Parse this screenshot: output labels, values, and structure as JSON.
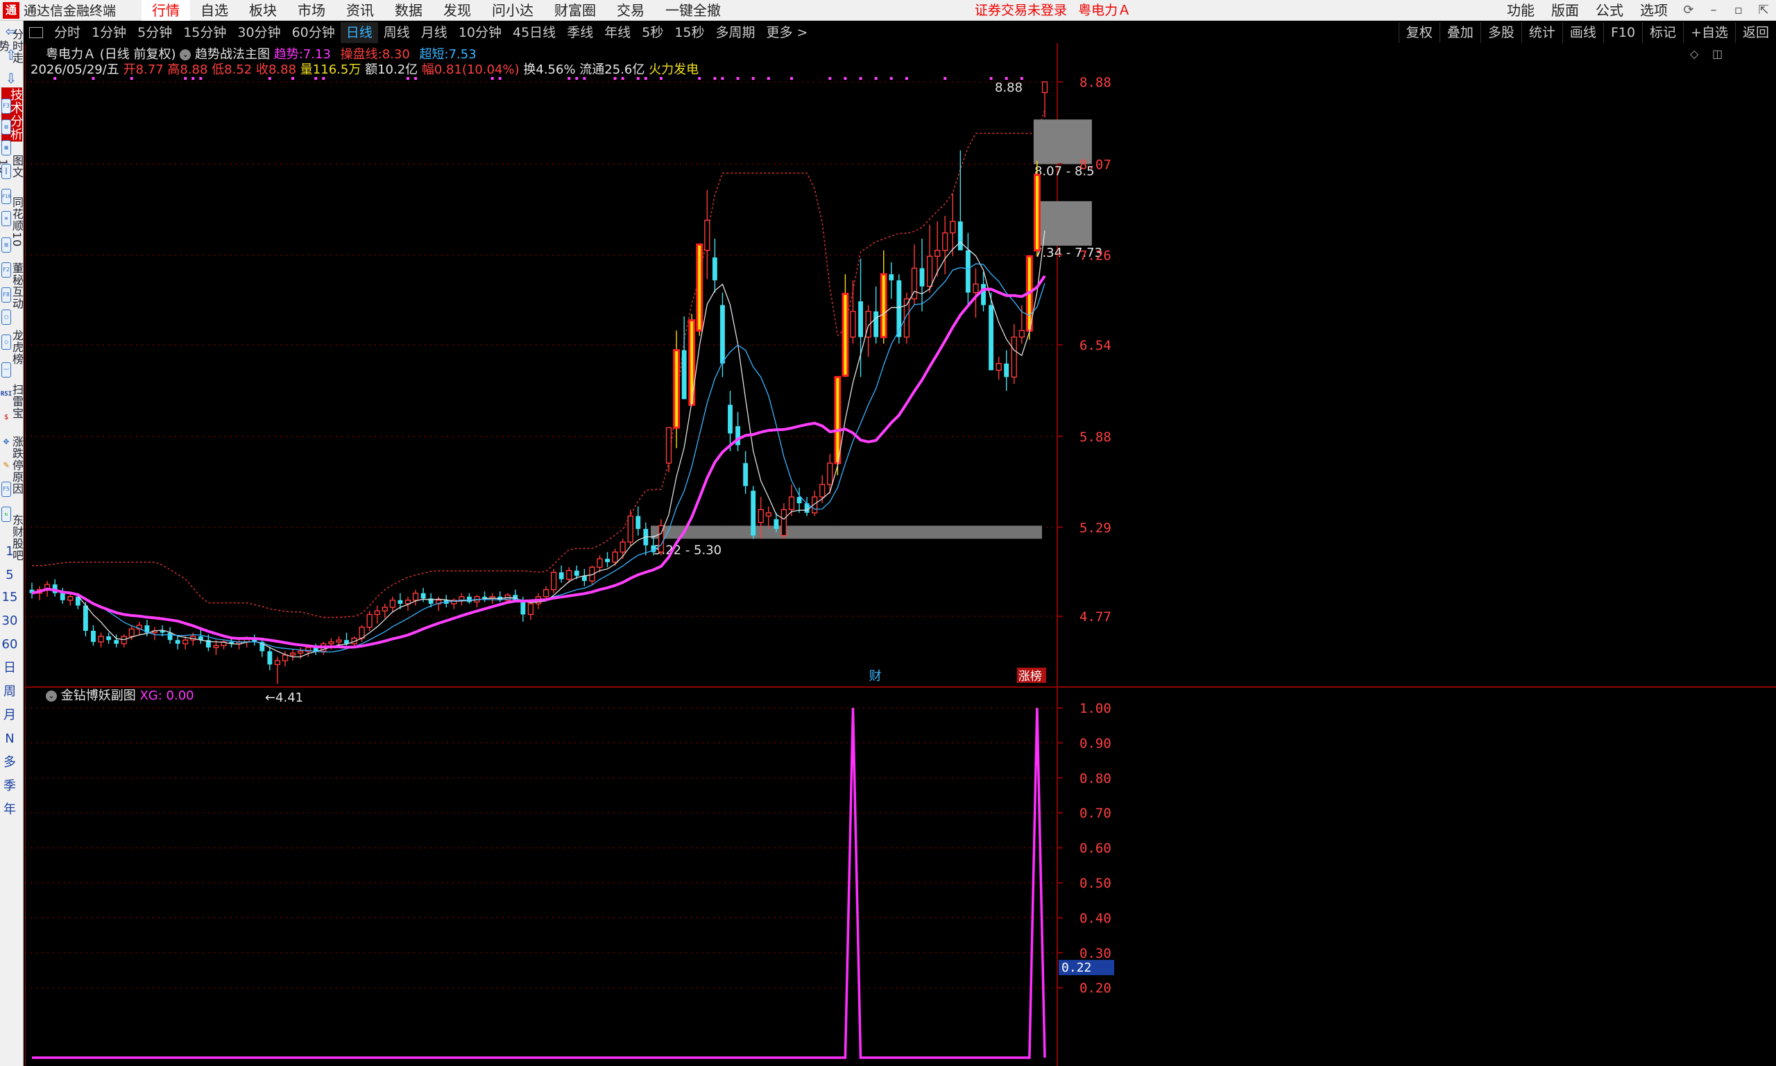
{
  "app": {
    "title": "通达信金融终端"
  },
  "menu": {
    "items": [
      "行情",
      "自选",
      "板块",
      "市场",
      "资讯",
      "数据",
      "发现",
      "问小达",
      "财富圈",
      "交易",
      "一键全撤"
    ],
    "active": "行情",
    "notice": "证券交易未登录",
    "notice_stock": "粤电力Ａ",
    "right": [
      "功能",
      "版面",
      "公式",
      "选项"
    ]
  },
  "sidebar": {
    "tabs": [
      "分时走势",
      "技术分析",
      "图文10",
      "同花顺10",
      "董秘互动",
      "龙虎榜",
      "扫雷宝",
      "涨跌停原因",
      "东财股吧"
    ],
    "active_tab": "技术分析",
    "icons": [
      "chart-icon",
      "grid-icon",
      "rsi-icon",
      "money-icon",
      "move-icon",
      "pencil-icon",
      "fs-icon"
    ],
    "icon_labels": [
      "F3",
      "F10",
      "F2",
      "F8",
      "RSI",
      "$",
      "F5"
    ],
    "periods": [
      "1",
      "5",
      "15",
      "30",
      "60",
      "日",
      "周",
      "月",
      "N",
      "多",
      "季",
      "年"
    ]
  },
  "toolbar": {
    "periods": [
      "分时",
      "1分钟",
      "5分钟",
      "15分钟",
      "30分钟",
      "60分钟",
      "日线",
      "周线",
      "月线",
      "10分钟",
      "45日线",
      "季线",
      "年线",
      "5秒",
      "15秒",
      "多周期",
      "更多 >"
    ],
    "active": "日线",
    "right": [
      "复权",
      "叠加",
      "多股",
      "统计",
      "画线",
      "F10",
      "标记",
      "+自选",
      "返回"
    ]
  },
  "stock": {
    "name": "粤电力Ａ",
    "mode": "(日线 前复权)",
    "formula": "趋势战法主图",
    "trend_label": "趋势:",
    "trend_value": "7.13",
    "control_label": "操盘线:",
    "control_value": "8.30",
    "short_label": "超短:",
    "short_value": "7.53",
    "date": "2026/05/29/五",
    "open_label": "开",
    "open": "8.77",
    "high_label": "高",
    "high": "8.88",
    "low_label": "低",
    "low": "8.52",
    "close_label": "收",
    "close": "8.88",
    "vol_label": "量",
    "vol": "116.5万",
    "amt_label": "额",
    "amt": "10.2亿",
    "chg_label": "幅",
    "chg": "0.81(10.04%)",
    "turnover_label": "换",
    "turnover": "4.56%",
    "float_label": "流通",
    "float": "25.6亿",
    "sector": "火力发电"
  },
  "sub": {
    "name": "金钻博妖副图",
    "xg_label": "XG:",
    "xg_value": "0.00",
    "current_value": "0.22"
  },
  "colors": {
    "up": "#ff3b3b",
    "down": "#40e0f0",
    "ma_long": "#ff40ff",
    "ma_short": "#e0e0e0",
    "band": "#c03030",
    "grid": "#8b0000",
    "box": "#808080",
    "limitup": "#ffdd00"
  },
  "chart_data": {
    "type": "candlestick",
    "y_ticks": [
      "8.88",
      "8.07",
      "7.26",
      "6.54",
      "5.88",
      "5.29",
      "4.77"
    ],
    "sub_y_ticks": [
      "1.00",
      "0.90",
      "0.80",
      "0.70",
      "0.60",
      "0.50",
      "0.40",
      "0.30",
      "0.20"
    ],
    "ylim": [
      4.5,
      8.95
    ],
    "annotations": {
      "low_mark": "←4.41",
      "high_mark": "8.88",
      "box1": "8.07 - 8.5",
      "box2": "7.34 - 7.73",
      "box3": "5.22 - 5.30",
      "tag_cai": "财",
      "tag_zhangbang": "涨榜"
    },
    "candles": [
      [
        4.92,
        4.96,
        4.87,
        4.9
      ],
      [
        4.9,
        4.94,
        4.86,
        4.92
      ],
      [
        4.92,
        4.97,
        4.88,
        4.95
      ],
      [
        4.95,
        4.98,
        4.88,
        4.9
      ],
      [
        4.9,
        4.93,
        4.84,
        4.86
      ],
      [
        4.86,
        4.9,
        4.83,
        4.88
      ],
      [
        4.88,
        4.9,
        4.81,
        4.83
      ],
      [
        4.83,
        4.85,
        4.66,
        4.69
      ],
      [
        4.69,
        4.72,
        4.61,
        4.63
      ],
      [
        4.63,
        4.68,
        4.6,
        4.66
      ],
      [
        4.66,
        4.68,
        4.62,
        4.64
      ],
      [
        4.64,
        4.67,
        4.6,
        4.62
      ],
      [
        4.62,
        4.67,
        4.6,
        4.66
      ],
      [
        4.66,
        4.72,
        4.64,
        4.7
      ],
      [
        4.7,
        4.74,
        4.67,
        4.72
      ],
      [
        4.72,
        4.75,
        4.66,
        4.68
      ],
      [
        4.68,
        4.71,
        4.64,
        4.69
      ],
      [
        4.69,
        4.72,
        4.66,
        4.68
      ],
      [
        4.68,
        4.71,
        4.62,
        4.64
      ],
      [
        4.64,
        4.66,
        4.59,
        4.62
      ],
      [
        4.62,
        4.66,
        4.59,
        4.64
      ],
      [
        4.64,
        4.68,
        4.61,
        4.66
      ],
      [
        4.66,
        4.7,
        4.62,
        4.64
      ],
      [
        4.64,
        4.67,
        4.58,
        4.6
      ],
      [
        4.6,
        4.64,
        4.56,
        4.61
      ],
      [
        4.61,
        4.64,
        4.59,
        4.63
      ],
      [
        4.63,
        4.65,
        4.6,
        4.62
      ],
      [
        4.62,
        4.64,
        4.59,
        4.63
      ],
      [
        4.63,
        4.66,
        4.6,
        4.65
      ],
      [
        4.65,
        4.67,
        4.61,
        4.63
      ],
      [
        4.63,
        4.65,
        4.55,
        4.58
      ],
      [
        4.58,
        4.6,
        4.48,
        4.51
      ],
      [
        4.51,
        4.55,
        4.41,
        4.53
      ],
      [
        4.53,
        4.58,
        4.5,
        4.56
      ],
      [
        4.56,
        4.59,
        4.53,
        4.57
      ],
      [
        4.57,
        4.6,
        4.54,
        4.58
      ],
      [
        4.58,
        4.61,
        4.55,
        4.6
      ],
      [
        4.6,
        4.62,
        4.56,
        4.58
      ],
      [
        4.58,
        4.63,
        4.56,
        4.62
      ],
      [
        4.62,
        4.65,
        4.59,
        4.63
      ],
      [
        4.63,
        4.66,
        4.6,
        4.64
      ],
      [
        4.64,
        4.68,
        4.61,
        4.62
      ],
      [
        4.62,
        4.66,
        4.6,
        4.65
      ],
      [
        4.65,
        4.72,
        4.63,
        4.71
      ],
      [
        4.71,
        4.8,
        4.69,
        4.78
      ],
      [
        4.78,
        4.83,
        4.73,
        4.8
      ],
      [
        4.8,
        4.84,
        4.76,
        4.82
      ],
      [
        4.82,
        4.88,
        4.79,
        4.86
      ],
      [
        4.86,
        4.9,
        4.81,
        4.84
      ],
      [
        4.84,
        4.88,
        4.8,
        4.86
      ],
      [
        4.86,
        4.92,
        4.83,
        4.9
      ],
      [
        4.9,
        4.93,
        4.85,
        4.87
      ],
      [
        4.87,
        4.9,
        4.82,
        4.84
      ],
      [
        4.84,
        4.88,
        4.8,
        4.86
      ],
      [
        4.86,
        4.89,
        4.82,
        4.84
      ],
      [
        4.84,
        4.87,
        4.81,
        4.86
      ],
      [
        4.86,
        4.9,
        4.83,
        4.88
      ],
      [
        4.88,
        4.9,
        4.84,
        4.85
      ],
      [
        4.85,
        4.89,
        4.82,
        4.88
      ],
      [
        4.88,
        4.91,
        4.85,
        4.87
      ],
      [
        4.87,
        4.9,
        4.84,
        4.88
      ],
      [
        4.88,
        4.91,
        4.85,
        4.86
      ],
      [
        4.86,
        4.9,
        4.84,
        4.89
      ],
      [
        4.89,
        4.92,
        4.85,
        4.86
      ],
      [
        4.86,
        4.88,
        4.74,
        4.78
      ],
      [
        4.78,
        4.86,
        4.75,
        4.84
      ],
      [
        4.84,
        4.9,
        4.81,
        4.88
      ],
      [
        4.88,
        4.94,
        4.86,
        4.92
      ],
      [
        4.92,
        5.04,
        4.9,
        5.02
      ],
      [
        5.02,
        5.06,
        4.96,
        4.98
      ],
      [
        4.98,
        5.05,
        4.96,
        5.03
      ],
      [
        5.03,
        5.06,
        4.98,
        5.0
      ],
      [
        5.0,
        5.04,
        4.94,
        4.97
      ],
      [
        4.97,
        5.06,
        4.95,
        5.05
      ],
      [
        5.05,
        5.12,
        5.02,
        5.1
      ],
      [
        5.1,
        5.14,
        5.05,
        5.08
      ],
      [
        5.08,
        5.16,
        5.06,
        5.14
      ],
      [
        5.14,
        5.22,
        5.1,
        5.2
      ],
      [
        5.2,
        5.4,
        5.18,
        5.36
      ],
      [
        5.36,
        5.42,
        5.24,
        5.28
      ],
      [
        5.28,
        5.32,
        5.12,
        5.18
      ],
      [
        5.18,
        5.24,
        5.12,
        5.14
      ],
      [
        5.14,
        5.34,
        5.12,
        5.3
      ],
      [
        5.7,
        5.92,
        5.64,
        5.94
      ],
      [
        5.94,
        6.65,
        5.8,
        6.5
      ],
      [
        6.5,
        6.76,
        6.35,
        6.14
      ],
      [
        6.1,
        6.78,
        6.1,
        6.73
      ],
      [
        6.65,
        7.25,
        6.61,
        7.35
      ],
      [
        7.3,
        7.83,
        7.06,
        7.56
      ],
      [
        7.24,
        7.4,
        6.95,
        7.05
      ],
      [
        6.85,
        6.95,
        6.3,
        6.4
      ],
      [
        6.1,
        6.2,
        5.78,
        5.9
      ],
      [
        5.95,
        6.05,
        5.78,
        5.82
      ],
      [
        5.7,
        5.78,
        5.5,
        5.55
      ],
      [
        5.52,
        5.55,
        5.22,
        5.24
      ],
      [
        5.32,
        5.48,
        5.22,
        5.4
      ],
      [
        5.36,
        5.42,
        5.28,
        5.38
      ],
      [
        5.34,
        5.38,
        5.26,
        5.28
      ],
      [
        5.24,
        5.44,
        5.22,
        5.4
      ],
      [
        5.4,
        5.56,
        5.36,
        5.48
      ],
      [
        5.48,
        5.54,
        5.38,
        5.44
      ],
      [
        5.44,
        5.48,
        5.36,
        5.38
      ],
      [
        5.38,
        5.52,
        5.36,
        5.48
      ],
      [
        5.48,
        5.62,
        5.44,
        5.56
      ],
      [
        5.56,
        5.76,
        5.5,
        5.7
      ],
      [
        5.7,
        6.3,
        5.62,
        6.3
      ],
      [
        6.31,
        7.1,
        6.3,
        6.94
      ],
      [
        6.6,
        7.05,
        6.55,
        6.8
      ],
      [
        6.88,
        7.23,
        6.3,
        6.6
      ],
      [
        6.6,
        6.85,
        6.45,
        6.8
      ],
      [
        6.8,
        7.0,
        6.55,
        6.6
      ],
      [
        6.6,
        7.3,
        6.55,
        7.1
      ],
      [
        7.1,
        7.2,
        6.9,
        7.05
      ],
      [
        7.05,
        7.1,
        6.55,
        6.6
      ],
      [
        6.6,
        6.95,
        6.55,
        6.9
      ],
      [
        6.9,
        7.35,
        6.85,
        7.15
      ],
      [
        7.15,
        7.4,
        6.8,
        7.0
      ],
      [
        7.0,
        7.52,
        6.95,
        7.25
      ],
      [
        7.25,
        7.55,
        7.08,
        7.3
      ],
      [
        7.3,
        7.6,
        7.1,
        7.45
      ],
      [
        7.45,
        7.8,
        7.25,
        7.55
      ],
      [
        7.55,
        8.2,
        7.35,
        7.3
      ],
      [
        7.3,
        7.45,
        6.85,
        6.95
      ],
      [
        6.95,
        7.15,
        6.75,
        7.02
      ],
      [
        7.02,
        7.12,
        6.8,
        6.85
      ],
      [
        6.85,
        6.95,
        6.35,
        6.35
      ],
      [
        6.35,
        6.45,
        6.28,
        6.4
      ],
      [
        6.4,
        6.5,
        6.2,
        6.3
      ],
      [
        6.3,
        6.7,
        6.25,
        6.6
      ],
      [
        6.6,
        6.85,
        6.55,
        6.65
      ],
      [
        6.65,
        7.25,
        6.58,
        7.25
      ],
      [
        7.3,
        8.1,
        7.25,
        7.97
      ],
      [
        8.77,
        8.88,
        8.52,
        8.88
      ]
    ],
    "sub_series": [
      0,
      0,
      0,
      0,
      0,
      0,
      0,
      0,
      0,
      0,
      0,
      0,
      0,
      0,
      0,
      0,
      0,
      0,
      0,
      0,
      0,
      0,
      0,
      0,
      0,
      0,
      0,
      0,
      0,
      0,
      0,
      0,
      0,
      0,
      0,
      0,
      0,
      0,
      0,
      0,
      0,
      0,
      0,
      0,
      0,
      0,
      0,
      0,
      0,
      0,
      0,
      0,
      0,
      0,
      0,
      0,
      0,
      0,
      0,
      0,
      0,
      0,
      0,
      0,
      0,
      0,
      0,
      0,
      0,
      0,
      0,
      0,
      0,
      0,
      0,
      0,
      0,
      0,
      0,
      0,
      0,
      0,
      0,
      0,
      0,
      0,
      0,
      0,
      0,
      0,
      0,
      0,
      0,
      0,
      0,
      0,
      0,
      0,
      0,
      0,
      0,
      0,
      0,
      0,
      0,
      0,
      0,
      1,
      0,
      0,
      0,
      0,
      0,
      0,
      0,
      0,
      0,
      0,
      0,
      0,
      0,
      0,
      0,
      0,
      0,
      0,
      0,
      0,
      0,
      0,
      0,
      1,
      0
    ]
  }
}
